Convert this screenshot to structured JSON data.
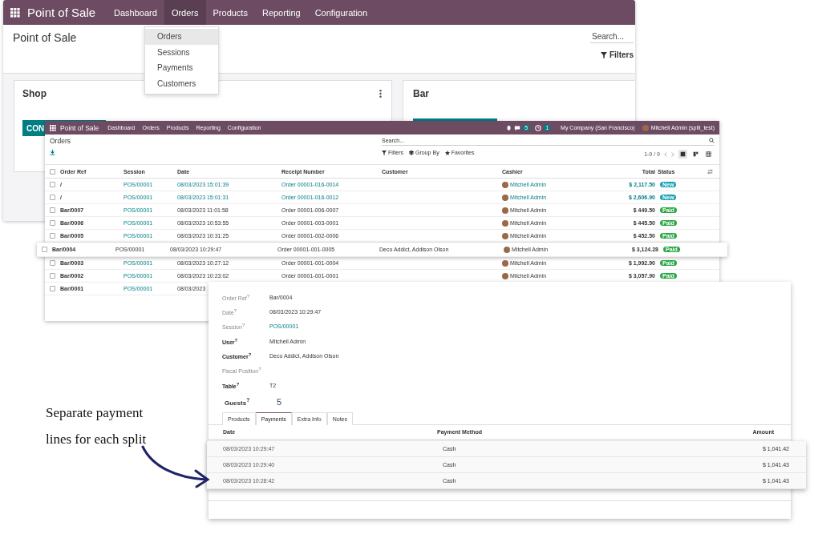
{
  "app_window": {
    "app_name": "Point of Sale",
    "menu": [
      {
        "label": "Dashboard",
        "selected": false
      },
      {
        "label": "Orders",
        "selected": true
      },
      {
        "label": "Products",
        "selected": false
      },
      {
        "label": "Reporting",
        "selected": false
      },
      {
        "label": "Configuration",
        "selected": false
      }
    ],
    "title": "Point of Sale",
    "search": {
      "placeholder": "Search..."
    },
    "filters_button": "Filters",
    "dropdown": [
      {
        "label": "Orders",
        "selected": true
      },
      {
        "label": "Sessions",
        "selected": false
      },
      {
        "label": "Payments",
        "selected": false
      },
      {
        "label": "Customers",
        "selected": false
      }
    ],
    "cards": [
      {
        "title": "Shop",
        "button": "CON"
      },
      {
        "title": "Bar"
      }
    ]
  },
  "orders_window": {
    "app_name": "Point of Sale",
    "menu": [
      "Dashboard",
      "Orders",
      "Products",
      "Reporting",
      "Configuration"
    ],
    "messages_count": "5",
    "activities_count": "1",
    "company": "My Company (San Francisco)",
    "user": "Mitchell Admin (split_test)",
    "title": "Orders",
    "search": {
      "placeholder": "Search..."
    },
    "filters": "Filters",
    "group_by": "Group By",
    "favorites": "Favorites",
    "pager": "1-9 / 9",
    "select_all_checked": false,
    "columns": [
      "Order Ref",
      "Session",
      "Date",
      "Receipt Number",
      "Customer",
      "Cashier",
      "Total",
      "Status"
    ],
    "rows": [
      {
        "checked": false,
        "ref": "/",
        "session": "POS/00001",
        "date": "08/03/2023 15:01:39",
        "receipt": "Order 00001-016-0014",
        "cashier": "Mitchell Admin",
        "total": "$ 2,117.50",
        "status": "New",
        "color": "#17a2b8",
        "raised": false
      },
      {
        "checked": false,
        "ref": "/",
        "session": "POS/00001",
        "date": "08/03/2023 15:01:31",
        "receipt": "Order 00001-016-0012",
        "cashier": "Mitchell Admin",
        "total": "$ 2,606.90",
        "status": "New",
        "color": "#17a2b8",
        "raised": false
      },
      {
        "checked": false,
        "ref": "Bar/0007",
        "session": "POS/00001",
        "date": "08/03/2023 11:01:58",
        "receipt": "Order 00001-006-0007",
        "cashier": "Mitchell Admin",
        "total": "$ 449.50",
        "status": "Paid",
        "color": "#28a745",
        "raised": false
      },
      {
        "checked": false,
        "ref": "Bar/0006",
        "session": "POS/00001",
        "date": "08/03/2023 10:53:55",
        "receipt": "Order 00001-003-0001",
        "cashier": "Mitchell Admin",
        "total": "$ 445.50",
        "status": "Paid",
        "color": "#28a745",
        "raised": false
      },
      {
        "checked": false,
        "ref": "Bar/0005",
        "session": "POS/00001",
        "date": "08/03/2023 10:31:25",
        "receipt": "Order 00001-002-0006",
        "cashier": "Mitchell Admin",
        "total": "$ 452.50",
        "status": "Paid",
        "color": "#28a745",
        "raised": false
      },
      {
        "checked": false,
        "ref": "Bar/0004",
        "session": "POS/00001",
        "date": "08/03/2023 10:29:47",
        "receipt": "Order 00001-001-0005",
        "customer": "Deco Addict, Addison Olson",
        "cashier": "Mitchell Admin",
        "total": "$ 3,124.28",
        "status": "Paid",
        "color": "#28a745",
        "raised": true
      },
      {
        "checked": false,
        "ref": "Bar/0003",
        "session": "POS/00001",
        "date": "08/03/2023 10:27:12",
        "receipt": "Order 00001-001-0004",
        "cashier": "Mitchell Admin",
        "total": "$ 1,992.90",
        "status": "Paid",
        "color": "#28a745",
        "raised": false
      },
      {
        "checked": false,
        "ref": "Bar/0002",
        "session": "POS/00001",
        "date": "08/03/2023 10:23:02",
        "receipt": "Order 00001-001-0001",
        "cashier": "Mitchell Admin",
        "total": "$ 3,057.90",
        "status": "Paid",
        "color": "#28a745",
        "raised": false
      },
      {
        "checked": false,
        "ref": "Bar/0001",
        "session": "POS/00001",
        "date": "08/03/2023",
        "raised": false
      }
    ]
  },
  "order_detail": {
    "fields": [
      {
        "label": "Order Ref$^{?}$",
        "value": "Bar/0004",
        "emphasis": false,
        "link": false
      },
      {
        "label": "Date$^{?}$",
        "value": "08/03/2023 10:29:47",
        "emphasis": false,
        "link": false
      },
      {
        "label": "Session$^{?}$",
        "value": "POS/00001",
        "emphasis": false,
        "link": true
      },
      {
        "label": "User$^{?}$",
        "value": "Mitchell Admin",
        "emphasis": true,
        "link": false
      },
      {
        "label": "Customer$^{?}$",
        "value": "Deco Addict, Addison Olson",
        "emphasis": true,
        "link": false
      },
      {
        "label": "Fiscal Position$^{?}$",
        "emphasis": false
      },
      {
        "label": "Table$^{?}$",
        "value": "T2",
        "emphasis": true,
        "link": false
      }
    ],
    "guests_label": "Guests$^{?}$",
    "guests": "5",
    "tabs": [
      {
        "label": "Products",
        "selected": false
      },
      {
        "label": "Payments",
        "selected": true
      },
      {
        "label": "Extra Info",
        "selected": false
      },
      {
        "label": "Notes",
        "selected": false
      }
    ],
    "payments": {
      "columns": [
        "Date",
        "Payment Method",
        "Amount"
      ],
      "rows": [
        {
          "date": "08/03/2023 10:29:47",
          "method": "Cash",
          "amount": "$ 1,041.42"
        },
        {
          "date": "08/03/2023 10:29:40",
          "method": "Cash",
          "amount": "$ 1,041.43"
        },
        {
          "date": "08/03/2023 10:28:42",
          "method": "Cash",
          "amount": "$ 1,041.43"
        }
      ]
    }
  },
  "annotation": [
    "Separate payment",
    "lines for each split"
  ]
}
